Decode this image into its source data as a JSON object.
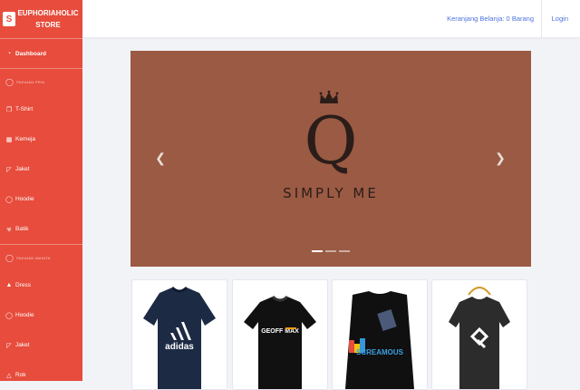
{
  "brand": {
    "logo_glyph": "S",
    "name": "EUPHORIAHOLIC STORE"
  },
  "sidebar": {
    "dashboard": {
      "label": "Dashboard",
      "icon": "dashboard-icon"
    },
    "sections": [
      {
        "heading": "PAKAIAN PRIA",
        "icon": "shirt-outline-icon",
        "items": [
          {
            "label": "T-Shirt",
            "icon": "tshirt-icon"
          },
          {
            "label": "Kemeja",
            "icon": "shirt-icon"
          },
          {
            "label": "Jaket",
            "icon": "jacket-icon"
          },
          {
            "label": "Hoodie",
            "icon": "hoodie-icon"
          },
          {
            "label": "Batik",
            "icon": "batik-icon"
          }
        ]
      },
      {
        "heading": "PAKAIAN WANITA",
        "icon": "shirt-outline-icon",
        "items": [
          {
            "label": "Dress",
            "icon": "dress-icon"
          },
          {
            "label": "Hoodie",
            "icon": "hoodie-icon"
          },
          {
            "label": "Jaket",
            "icon": "jacket-icon"
          },
          {
            "label": "Rok",
            "icon": "skirt-icon"
          }
        ]
      }
    ]
  },
  "topbar": {
    "cart_label": "Keranjang Belanja: 0 Barang",
    "login_label": "Login"
  },
  "carousel": {
    "slide_logo_letter": "Q",
    "slide_caption": "SIMPLY ME",
    "background_color": "#9b5a43",
    "indicators": [
      true,
      false,
      false
    ]
  },
  "products": [
    {
      "name": "adidas t-shirt",
      "print_text": "adidas",
      "color": "#1c2a44"
    },
    {
      "name": "geoffmax t-shirt",
      "print_text": "GEOFF MAX",
      "color": "#111111"
    },
    {
      "name": "screamous t-shirt",
      "print_text": "SCREAMOUS",
      "color": "#101010"
    },
    {
      "name": "logo t-shirt",
      "print_text": "",
      "color": "#2c2c2c"
    }
  ],
  "colors": {
    "sidebar": "#e74c3c",
    "link": "#4e73df",
    "page_bg": "#f2f3f7"
  }
}
